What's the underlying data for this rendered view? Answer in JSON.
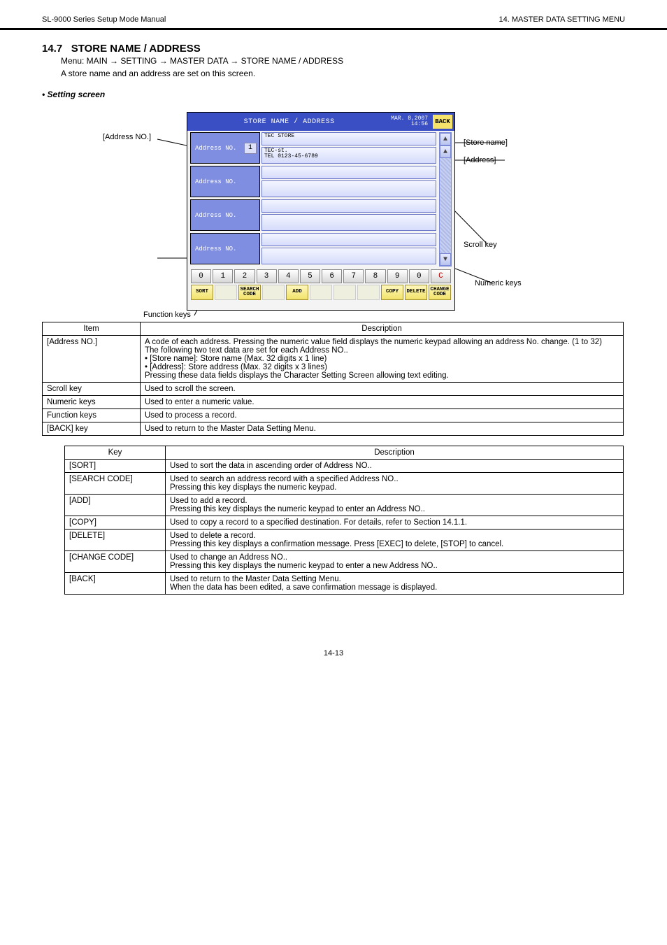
{
  "header": {
    "left": "SL-9000 Series Setup Mode Manual",
    "right": "14. MASTER DATA SETTING MENU"
  },
  "section": {
    "number": "14.7",
    "title": "STORE NAME / ADDRESS",
    "desc": "Menu: MAIN → SETTING → MASTER DATA → STORE NAME / ADDRESS",
    "desc2": "A store name and an address are set on this screen."
  },
  "screen_label": "• Setting screen",
  "ui": {
    "title": "STORE NAME / ADDRESS",
    "date": "MAR. 8,2007\n14:56",
    "back": "BACK",
    "row_label": "Address NO.",
    "row1_num": "1",
    "store_name_cell": "TEC STORE",
    "address_cell": "TEC-st.\nTEL 0123-45-6789",
    "numpad": [
      "0",
      "1",
      "2",
      "3",
      "4",
      "5",
      "6",
      "7",
      "8",
      "9",
      "0",
      "C"
    ],
    "funcs": [
      "SORT",
      "",
      "SEARCH CODE",
      "",
      "ADD",
      "",
      "",
      "",
      "COPY",
      "DELETE",
      "CHANGE CODE"
    ]
  },
  "callouts": {
    "a": "[Address NO.]",
    "b": "[Store name]",
    "c": "[Address]",
    "d": "Scroll key",
    "e": "Numeric keys",
    "f": "Function keys"
  },
  "table_items": {
    "header": [
      "Item",
      "Description"
    ],
    "rows": [
      [
        "[Address NO.]",
        "A code of each address. Pressing the numeric value field displays the numeric keypad allowing an address No. change. (1 to 32)\nThe following two text data are set for each Address NO..\n  • [Store name]: Store name (Max. 32 digits x 1 line)\n  • [Address]: Store address (Max. 32 digits x 3 lines)\nPressing these data fields displays the Character Setting Screen allowing text editing."
      ],
      [
        "Scroll key",
        "Used to scroll the screen."
      ],
      [
        "Numeric keys",
        "Used to enter a numeric value."
      ],
      [
        "Function keys",
        "Used to process a record."
      ],
      [
        "[BACK] key",
        "Used to return to the Master Data Setting Menu."
      ]
    ]
  },
  "table_keys": {
    "header": [
      "Key",
      "Description"
    ],
    "rows": [
      [
        "[SORT]",
        "Used to sort the data in ascending order of Address NO.."
      ],
      [
        "[SEARCH CODE]",
        "Used to search an address record with a specified Address NO..\nPressing this key displays the numeric keypad."
      ],
      [
        "[ADD]",
        "Used to add a record.\nPressing this key displays the numeric keypad to enter an Address NO.."
      ],
      [
        "[COPY]",
        "Used to copy a record to a specified destination. For details, refer to Section 14.1.1."
      ],
      [
        "[DELETE]",
        "Used to delete a record.\nPressing this key displays a confirmation message.  Press [EXEC] to delete, [STOP] to cancel."
      ],
      [
        "[CHANGE CODE]",
        "Used to change an Address NO..\nPressing this key displays the numeric keypad to enter a new Address NO.."
      ],
      [
        "[BACK]",
        "Used to return to the Master Data Setting Menu.\nWhen the data has been edited, a save confirmation message is displayed."
      ]
    ]
  },
  "page_num": "14-13"
}
